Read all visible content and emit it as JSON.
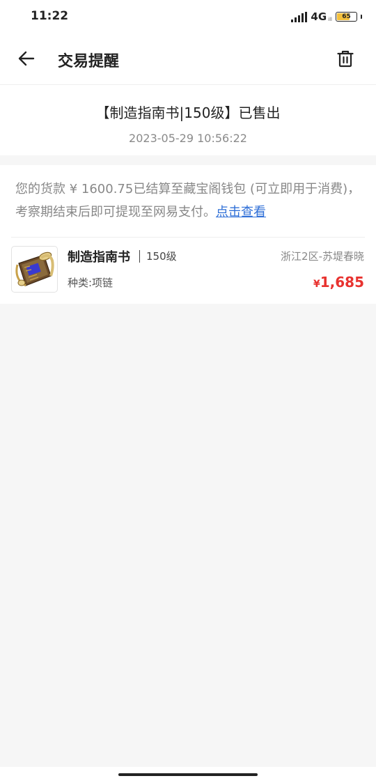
{
  "status_bar": {
    "time": "11:22",
    "network": "4G",
    "network_sub": "ill",
    "battery_level": "65",
    "battery_fraction": 0.65,
    "battery_color": "#f4c03c"
  },
  "nav": {
    "back_icon": "arrow-left-icon",
    "title": "交易提醒",
    "delete_icon": "trash-icon"
  },
  "notice": {
    "title": "【制造指南书|150级】已售出",
    "time": "2023-05-29 10:56:22"
  },
  "message": {
    "text": "您的货款 ¥ 1600.75已结算至藏宝阁钱包 (可立即用于消费)，考察期结束后即可提现至网易支付。",
    "link_text": "点击查看",
    "link_color": "#2f6fd7"
  },
  "item": {
    "thumbnail_icon": "scroll-icon",
    "name": "制造指南书",
    "level": "150级",
    "server": "浙江2区-苏堤春晓",
    "category": "种类:项链",
    "price_symbol": "¥",
    "price": "1,685",
    "price_color": "#e8322f"
  }
}
